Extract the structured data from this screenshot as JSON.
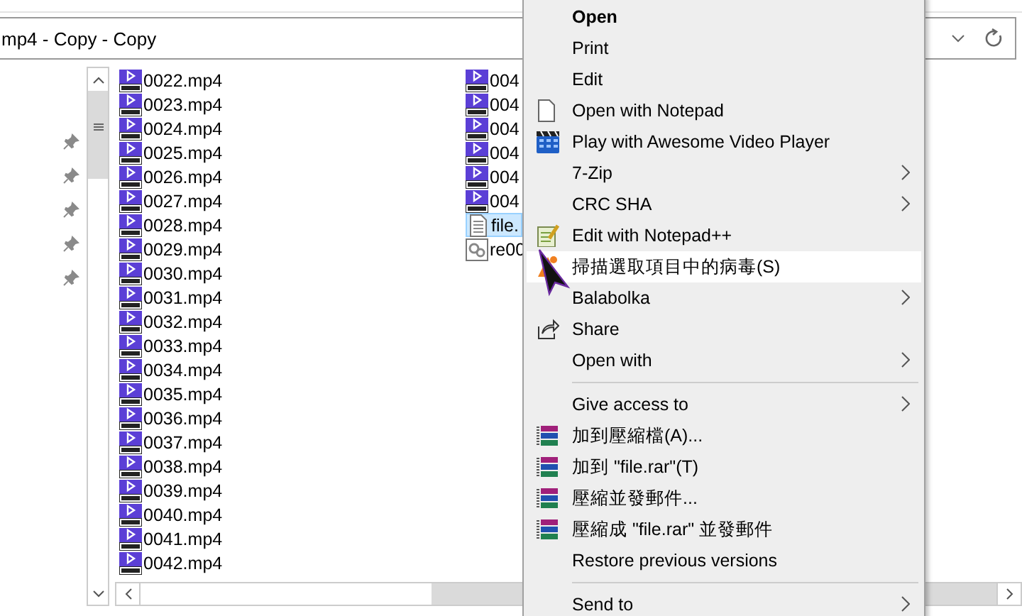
{
  "address_bar": {
    "path": "mp4 - Copy - Copy"
  },
  "files": {
    "columns": [
      {
        "items": [
          {
            "name": "0022.mp4",
            "kind": "video",
            "selected": false
          },
          {
            "name": "0023.mp4",
            "kind": "video",
            "selected": false
          },
          {
            "name": "0024.mp4",
            "kind": "video",
            "selected": false
          },
          {
            "name": "0025.mp4",
            "kind": "video",
            "selected": false
          },
          {
            "name": "0026.mp4",
            "kind": "video",
            "selected": false
          },
          {
            "name": "0027.mp4",
            "kind": "video",
            "selected": false
          },
          {
            "name": "0028.mp4",
            "kind": "video",
            "selected": false
          },
          {
            "name": "0029.mp4",
            "kind": "video",
            "selected": false
          },
          {
            "name": "0030.mp4",
            "kind": "video",
            "selected": false
          },
          {
            "name": "0031.mp4",
            "kind": "video",
            "selected": false
          },
          {
            "name": "0032.mp4",
            "kind": "video",
            "selected": false
          },
          {
            "name": "0033.mp4",
            "kind": "video",
            "selected": false
          },
          {
            "name": "0034.mp4",
            "kind": "video",
            "selected": false
          },
          {
            "name": "0035.mp4",
            "kind": "video",
            "selected": false
          },
          {
            "name": "0036.mp4",
            "kind": "video",
            "selected": false
          },
          {
            "name": "0037.mp4",
            "kind": "video",
            "selected": false
          },
          {
            "name": "0038.mp4",
            "kind": "video",
            "selected": false
          },
          {
            "name": "0039.mp4",
            "kind": "video",
            "selected": false
          },
          {
            "name": "0040.mp4",
            "kind": "video",
            "selected": false
          },
          {
            "name": "0041.mp4",
            "kind": "video",
            "selected": false
          },
          {
            "name": "0042.mp4",
            "kind": "video",
            "selected": false
          }
        ]
      },
      {
        "items": [
          {
            "name": "004",
            "kind": "video",
            "selected": false
          },
          {
            "name": "004",
            "kind": "video",
            "selected": false
          },
          {
            "name": "004",
            "kind": "video",
            "selected": false
          },
          {
            "name": "004",
            "kind": "video",
            "selected": false
          },
          {
            "name": "004",
            "kind": "video",
            "selected": false
          },
          {
            "name": "004",
            "kind": "video",
            "selected": false
          },
          {
            "name": "file.",
            "kind": "text",
            "selected": true
          },
          {
            "name": "re00",
            "kind": "settings",
            "selected": false
          }
        ]
      }
    ]
  },
  "context_menu": {
    "items": [
      {
        "label": "Open",
        "kind": "plain",
        "bold": true,
        "submenu": false,
        "highlighted": false
      },
      {
        "label": "Print",
        "kind": "plain",
        "bold": false,
        "submenu": false,
        "highlighted": false
      },
      {
        "label": "Edit",
        "kind": "plain",
        "bold": false,
        "submenu": false,
        "highlighted": false
      },
      {
        "label": "Open with Notepad",
        "kind": "page",
        "bold": false,
        "submenu": false,
        "highlighted": false
      },
      {
        "label": "Play with Awesome Video Player",
        "kind": "clapper",
        "bold": false,
        "submenu": false,
        "highlighted": false
      },
      {
        "label": "7-Zip",
        "kind": "plain",
        "bold": false,
        "submenu": true,
        "highlighted": false
      },
      {
        "label": "CRC SHA",
        "kind": "plain",
        "bold": false,
        "submenu": true,
        "highlighted": false
      },
      {
        "label": "Edit with Notepad++",
        "kind": "notepad",
        "bold": false,
        "submenu": false,
        "highlighted": false
      },
      {
        "label": "掃描選取項目中的病毒(S)",
        "kind": "antivirus",
        "bold": false,
        "submenu": false,
        "highlighted": true
      },
      {
        "label": "Balabolka",
        "kind": "plain",
        "bold": false,
        "submenu": true,
        "highlighted": false
      },
      {
        "label": "Share",
        "kind": "share",
        "bold": false,
        "submenu": false,
        "highlighted": false
      },
      {
        "label": "Open with",
        "kind": "plain",
        "bold": false,
        "submenu": true,
        "highlighted": false
      },
      {
        "kind": "separator"
      },
      {
        "label": "Give access to",
        "kind": "plain",
        "bold": false,
        "submenu": true,
        "highlighted": false
      },
      {
        "label": "加到壓縮檔(A)...",
        "kind": "archive",
        "bold": false,
        "submenu": false,
        "highlighted": false
      },
      {
        "label": "加到 \"file.rar\"(T)",
        "kind": "archive",
        "bold": false,
        "submenu": false,
        "highlighted": false
      },
      {
        "label": "壓縮並發郵件...",
        "kind": "archive",
        "bold": false,
        "submenu": false,
        "highlighted": false
      },
      {
        "label": "壓縮成 \"file.rar\" 並發郵件",
        "kind": "archive",
        "bold": false,
        "submenu": false,
        "highlighted": false
      },
      {
        "label": "Restore previous versions",
        "kind": "plain",
        "bold": false,
        "submenu": false,
        "highlighted": false
      },
      {
        "kind": "separator"
      },
      {
        "label": "Send to",
        "kind": "plain",
        "bold": false,
        "submenu": true,
        "highlighted": false
      }
    ]
  }
}
